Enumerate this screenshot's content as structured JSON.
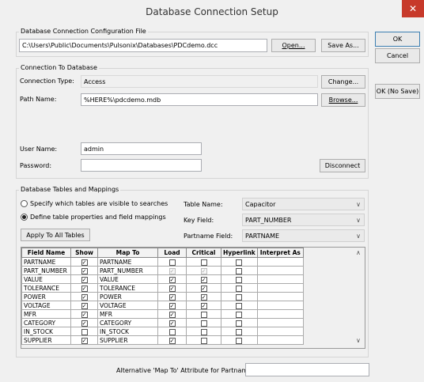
{
  "window": {
    "title": "Database Connection Setup",
    "close_glyph": "✕"
  },
  "side_buttons": {
    "ok": "OK",
    "cancel": "Cancel",
    "ok_no_save": "OK (No Save)"
  },
  "config_file": {
    "group_label": "Database Connection Configuration File",
    "path": "C:\\Users\\Public\\Documents\\Pulsonix\\Databases\\PDCdemo.dcc",
    "open_label": "Open...",
    "save_as_label": "Save As..."
  },
  "connection": {
    "group_label": "Connection To Database",
    "type_label": "Connection Type:",
    "type_value": "Access",
    "change_label": "Change...",
    "path_label": "Path Name:",
    "path_value": "%HERE%\\pdcdemo.mdb",
    "browse_label": "Browse...",
    "user_label": "User Name:",
    "user_value": "admin",
    "password_label": "Password:",
    "password_value": "",
    "disconnect_label": "Disconnect"
  },
  "mappings": {
    "group_label": "Database Tables and Mappings",
    "radio_specify": "Specify which tables are visible to searches",
    "radio_define": "Define table properties and field mappings",
    "apply_all_label": "Apply To All Tables",
    "table_name_label": "Table Name:",
    "table_name_value": "Capacitor",
    "key_field_label": "Key Field:",
    "key_field_value": "PART_NUMBER",
    "partname_field_label": "Partname Field:",
    "partname_field_value": "PARTNAME",
    "columns": [
      "Field Name",
      "Show",
      "Map To",
      "Load",
      "Critical",
      "Hyperlink",
      "Interpret As"
    ],
    "rows": [
      {
        "field": "PARTNAME",
        "show": true,
        "map": "PARTNAME",
        "load": false,
        "load_dis": false,
        "critical": false,
        "critical_dis": false,
        "hyperlink": false
      },
      {
        "field": "PART_NUMBER",
        "show": true,
        "map": "PART_NUMBER",
        "load": true,
        "load_dis": true,
        "critical": true,
        "critical_dis": true,
        "hyperlink": false
      },
      {
        "field": "VALUE",
        "show": true,
        "map": "VALUE",
        "load": true,
        "load_dis": false,
        "critical": true,
        "critical_dis": false,
        "hyperlink": false
      },
      {
        "field": "TOLERANCE",
        "show": true,
        "map": "TOLERANCE",
        "load": true,
        "load_dis": false,
        "critical": true,
        "critical_dis": false,
        "hyperlink": false
      },
      {
        "field": "POWER",
        "show": true,
        "map": "POWER",
        "load": true,
        "load_dis": false,
        "critical": true,
        "critical_dis": false,
        "hyperlink": false
      },
      {
        "field": "VOLTAGE",
        "show": true,
        "map": "VOLTAGE",
        "load": true,
        "load_dis": false,
        "critical": true,
        "critical_dis": false,
        "hyperlink": false
      },
      {
        "field": "MFR",
        "show": true,
        "map": "MFR",
        "load": true,
        "load_dis": false,
        "critical": false,
        "critical_dis": false,
        "hyperlink": false
      },
      {
        "field": "CATEGORY",
        "show": true,
        "map": "CATEGORY",
        "load": true,
        "load_dis": false,
        "critical": false,
        "critical_dis": false,
        "hyperlink": false
      },
      {
        "field": "IN_STOCK",
        "show": false,
        "map": "IN_STOCK",
        "load": false,
        "load_dis": false,
        "critical": false,
        "critical_dis": false,
        "hyperlink": false
      },
      {
        "field": "SUPPLIER",
        "show": true,
        "map": "SUPPLIER",
        "load": true,
        "load_dis": false,
        "critical": false,
        "critical_dis": false,
        "hyperlink": false
      }
    ],
    "check_glyph": "✓",
    "alt_map_label": "Alternative 'Map To' Attribute for Partname:",
    "alt_map_value": ""
  }
}
